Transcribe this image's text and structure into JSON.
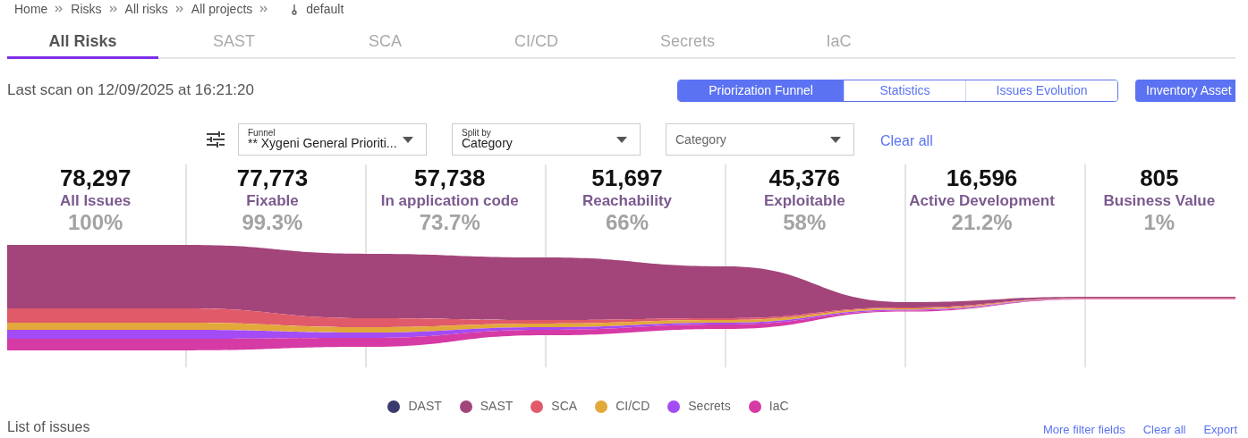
{
  "breadcrumb": [
    {
      "label": "Home"
    },
    {
      "label": "Risks"
    },
    {
      "label": "All risks"
    },
    {
      "label": "All projects"
    },
    {
      "label": "default",
      "kind": "project"
    }
  ],
  "tabs": [
    {
      "label": "All Risks",
      "selected": true
    },
    {
      "label": "SAST",
      "selected": false
    },
    {
      "label": "SCA",
      "selected": false
    },
    {
      "label": "CI/CD",
      "selected": false
    },
    {
      "label": "Secrets",
      "selected": false
    },
    {
      "label": "IaC",
      "selected": false
    }
  ],
  "last_scan": "Last scan on 12/09/2025 at 16:21:20",
  "view_toggle": [
    {
      "label": "Priorization Funnel",
      "selected": true
    },
    {
      "label": "Statistics",
      "selected": false
    },
    {
      "label": "Issues Evolution",
      "selected": false
    }
  ],
  "inventory_button": "Inventory Asset",
  "filters": {
    "funnel": {
      "label": "Funnel",
      "value": "** Xygeni General Prioriti..."
    },
    "split_by": {
      "label": "Split by",
      "value": "Category"
    },
    "category": {
      "placeholder": "Category"
    },
    "clear_all": "Clear all"
  },
  "stages": [
    {
      "count": "78,297",
      "label": "All Issues",
      "percent": "100%"
    },
    {
      "count": "77,773",
      "label": "Fixable",
      "percent": "99.3%"
    },
    {
      "count": "57,738",
      "label": "In application code",
      "percent": "73.7%"
    },
    {
      "count": "51,697",
      "label": "Reachability",
      "percent": "66%"
    },
    {
      "count": "45,376",
      "label": "Exploitable",
      "percent": "58%"
    },
    {
      "count": "16,596",
      "label": "Active Development",
      "percent": "21.2%"
    },
    {
      "count": "805",
      "label": "Business Value",
      "percent": "1%"
    }
  ],
  "legend": [
    {
      "label": "DAST",
      "color": "#3b3a6e"
    },
    {
      "label": "SAST",
      "color": "#a3457a"
    },
    {
      "label": "SCA",
      "color": "#e05a6a"
    },
    {
      "label": "CI/CD",
      "color": "#e3a83a"
    },
    {
      "label": "Secrets",
      "color": "#a34cf5"
    },
    {
      "label": "IaC",
      "color": "#d63aa5"
    }
  ],
  "list": {
    "title": "List of issues",
    "links": [
      "More filter fields",
      "Clear all",
      "Export"
    ]
  }
}
